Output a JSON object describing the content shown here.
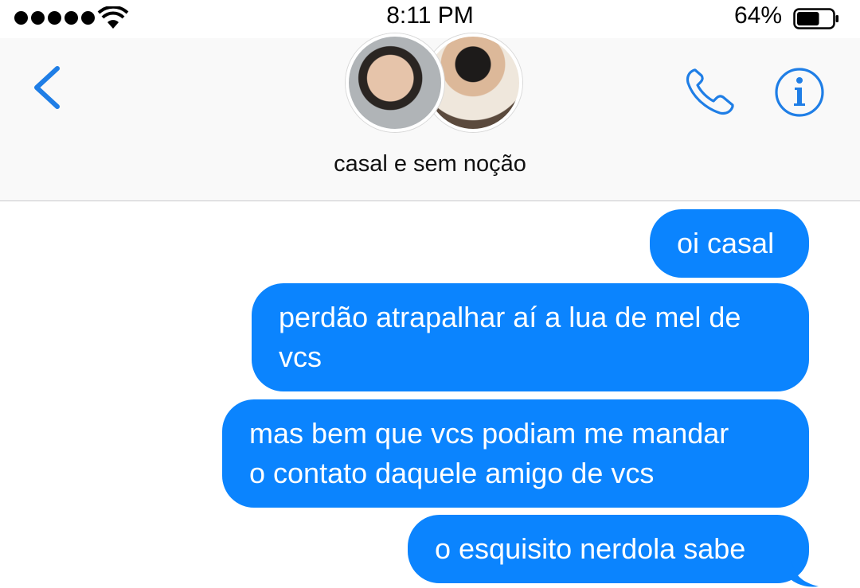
{
  "status_bar": {
    "time": "8:11 PM",
    "battery_percent": "64%",
    "battery_level": 0.64,
    "signal_bars": 5,
    "icons": [
      "signal-dots-icon",
      "wifi-icon",
      "battery-icon"
    ]
  },
  "header": {
    "group_name": "casal e sem noção",
    "icons": [
      "chevron-left-icon",
      "phone-icon",
      "info-icon"
    ],
    "avatars": [
      "group-member-avatar-1",
      "group-member-avatar-2"
    ]
  },
  "messages": [
    {
      "text": "oi casal",
      "direction": "outgoing"
    },
    {
      "text": "perdão atrapalhar aí a lua de mel de\nvcs",
      "direction": "outgoing"
    },
    {
      "text": "mas bem que vcs podiam me mandar\no contato daquele amigo de vcs",
      "direction": "outgoing"
    },
    {
      "text": "o esquisito nerdola sabe",
      "direction": "outgoing"
    }
  ],
  "colors": {
    "accent": "#0b84fe",
    "icon_blue": "#1f7ee6",
    "bubble_text": "#ffffff",
    "header_bg": "#f9f9f9"
  }
}
